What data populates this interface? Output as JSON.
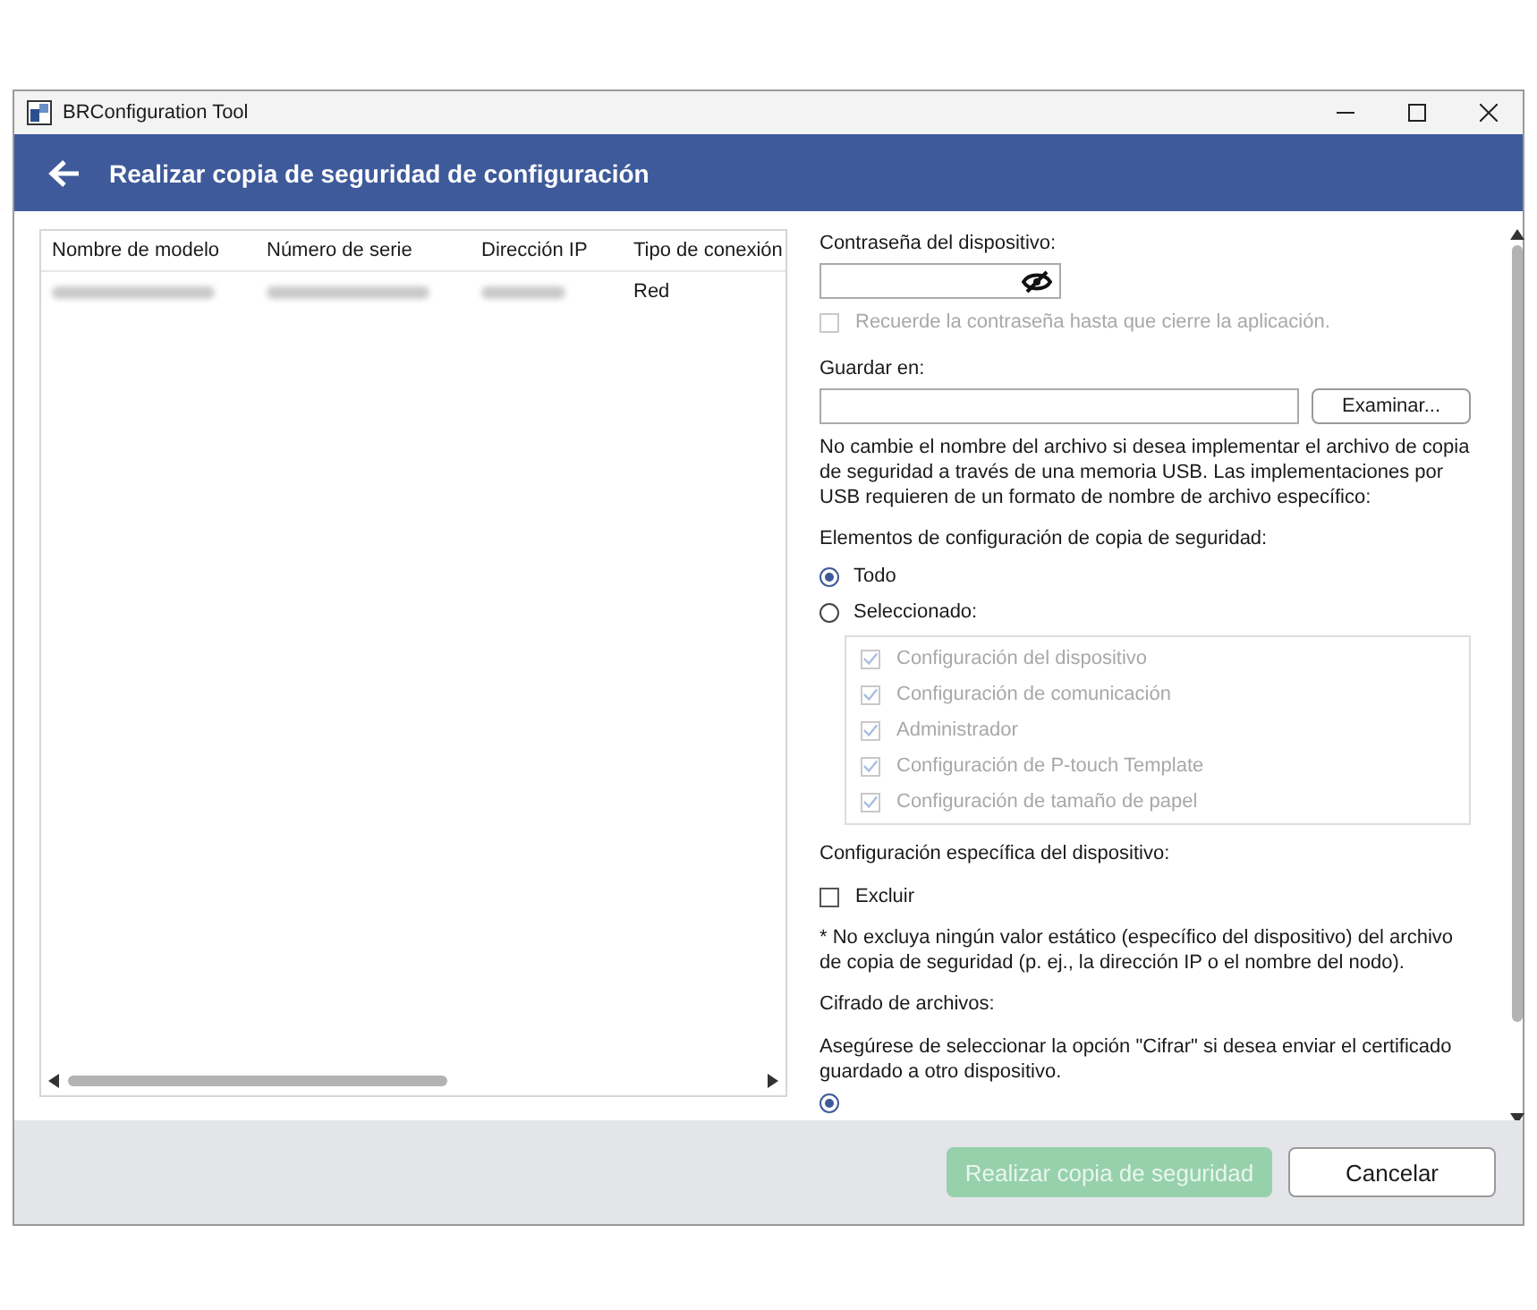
{
  "window": {
    "title": "BRConfiguration Tool"
  },
  "header": {
    "title": "Realizar copia de seguridad de configuración"
  },
  "table": {
    "columns": [
      "Nombre de modelo",
      "Número de serie",
      "Dirección IP",
      "Tipo de conexión"
    ],
    "rows": [
      {
        "cells": [
          {
            "kind": "blurred"
          },
          {
            "kind": "blurred"
          },
          {
            "kind": "blurred"
          },
          {
            "kind": "text",
            "text": "Red"
          }
        ]
      }
    ]
  },
  "password": {
    "label": "Contraseña del dispositivo:",
    "remember": {
      "label": "Recuerde la contraseña hasta que cierre la aplicación.",
      "checked": false,
      "disabled": true
    }
  },
  "save_to": {
    "label": "Guardar en:",
    "button": "Examinar...",
    "note": "No cambie el nombre del archivo si desea implementar el archivo de copia de seguridad a través de una memoria USB. Las implementaciones por USB requieren de un formato de nombre de archivo específico:"
  },
  "backup_items": {
    "label": "Elementos de configuración de copia de seguridad:",
    "options": [
      {
        "label": "Todo",
        "selected": true
      },
      {
        "label": "Seleccionado:",
        "selected": false
      }
    ],
    "items": [
      {
        "label": "Configuración del dispositivo",
        "checked": true,
        "disabled": true
      },
      {
        "label": "Configuración de comunicación",
        "checked": true,
        "disabled": true
      },
      {
        "label": "Administrador",
        "checked": true,
        "disabled": true
      },
      {
        "label": "Configuración de P-touch Template",
        "checked": true,
        "disabled": true
      },
      {
        "label": "Configuración de tamaño de papel",
        "checked": true,
        "disabled": true
      }
    ]
  },
  "device_specific": {
    "label": "Configuración específica del dispositivo:",
    "exclude": {
      "label": "Excluir",
      "checked": false
    },
    "note": "* No excluya ningún valor estático (específico del dispositivo) del archivo de copia de seguridad (p. ej., la dirección IP o el nombre del nodo)."
  },
  "encryption": {
    "label": "Cifrado de archivos:",
    "note": "Asegúrese de seleccionar la opción \"Cifrar\" si desea enviar el certificado guardado a otro dispositivo.",
    "options": [
      {
        "selected": true
      }
    ]
  },
  "buttons": [
    {
      "label": "Realizar copia de seguridad",
      "kind": "primary",
      "disabled": true
    },
    {
      "label": "Cancelar",
      "kind": "secondary",
      "disabled": false
    }
  ]
}
